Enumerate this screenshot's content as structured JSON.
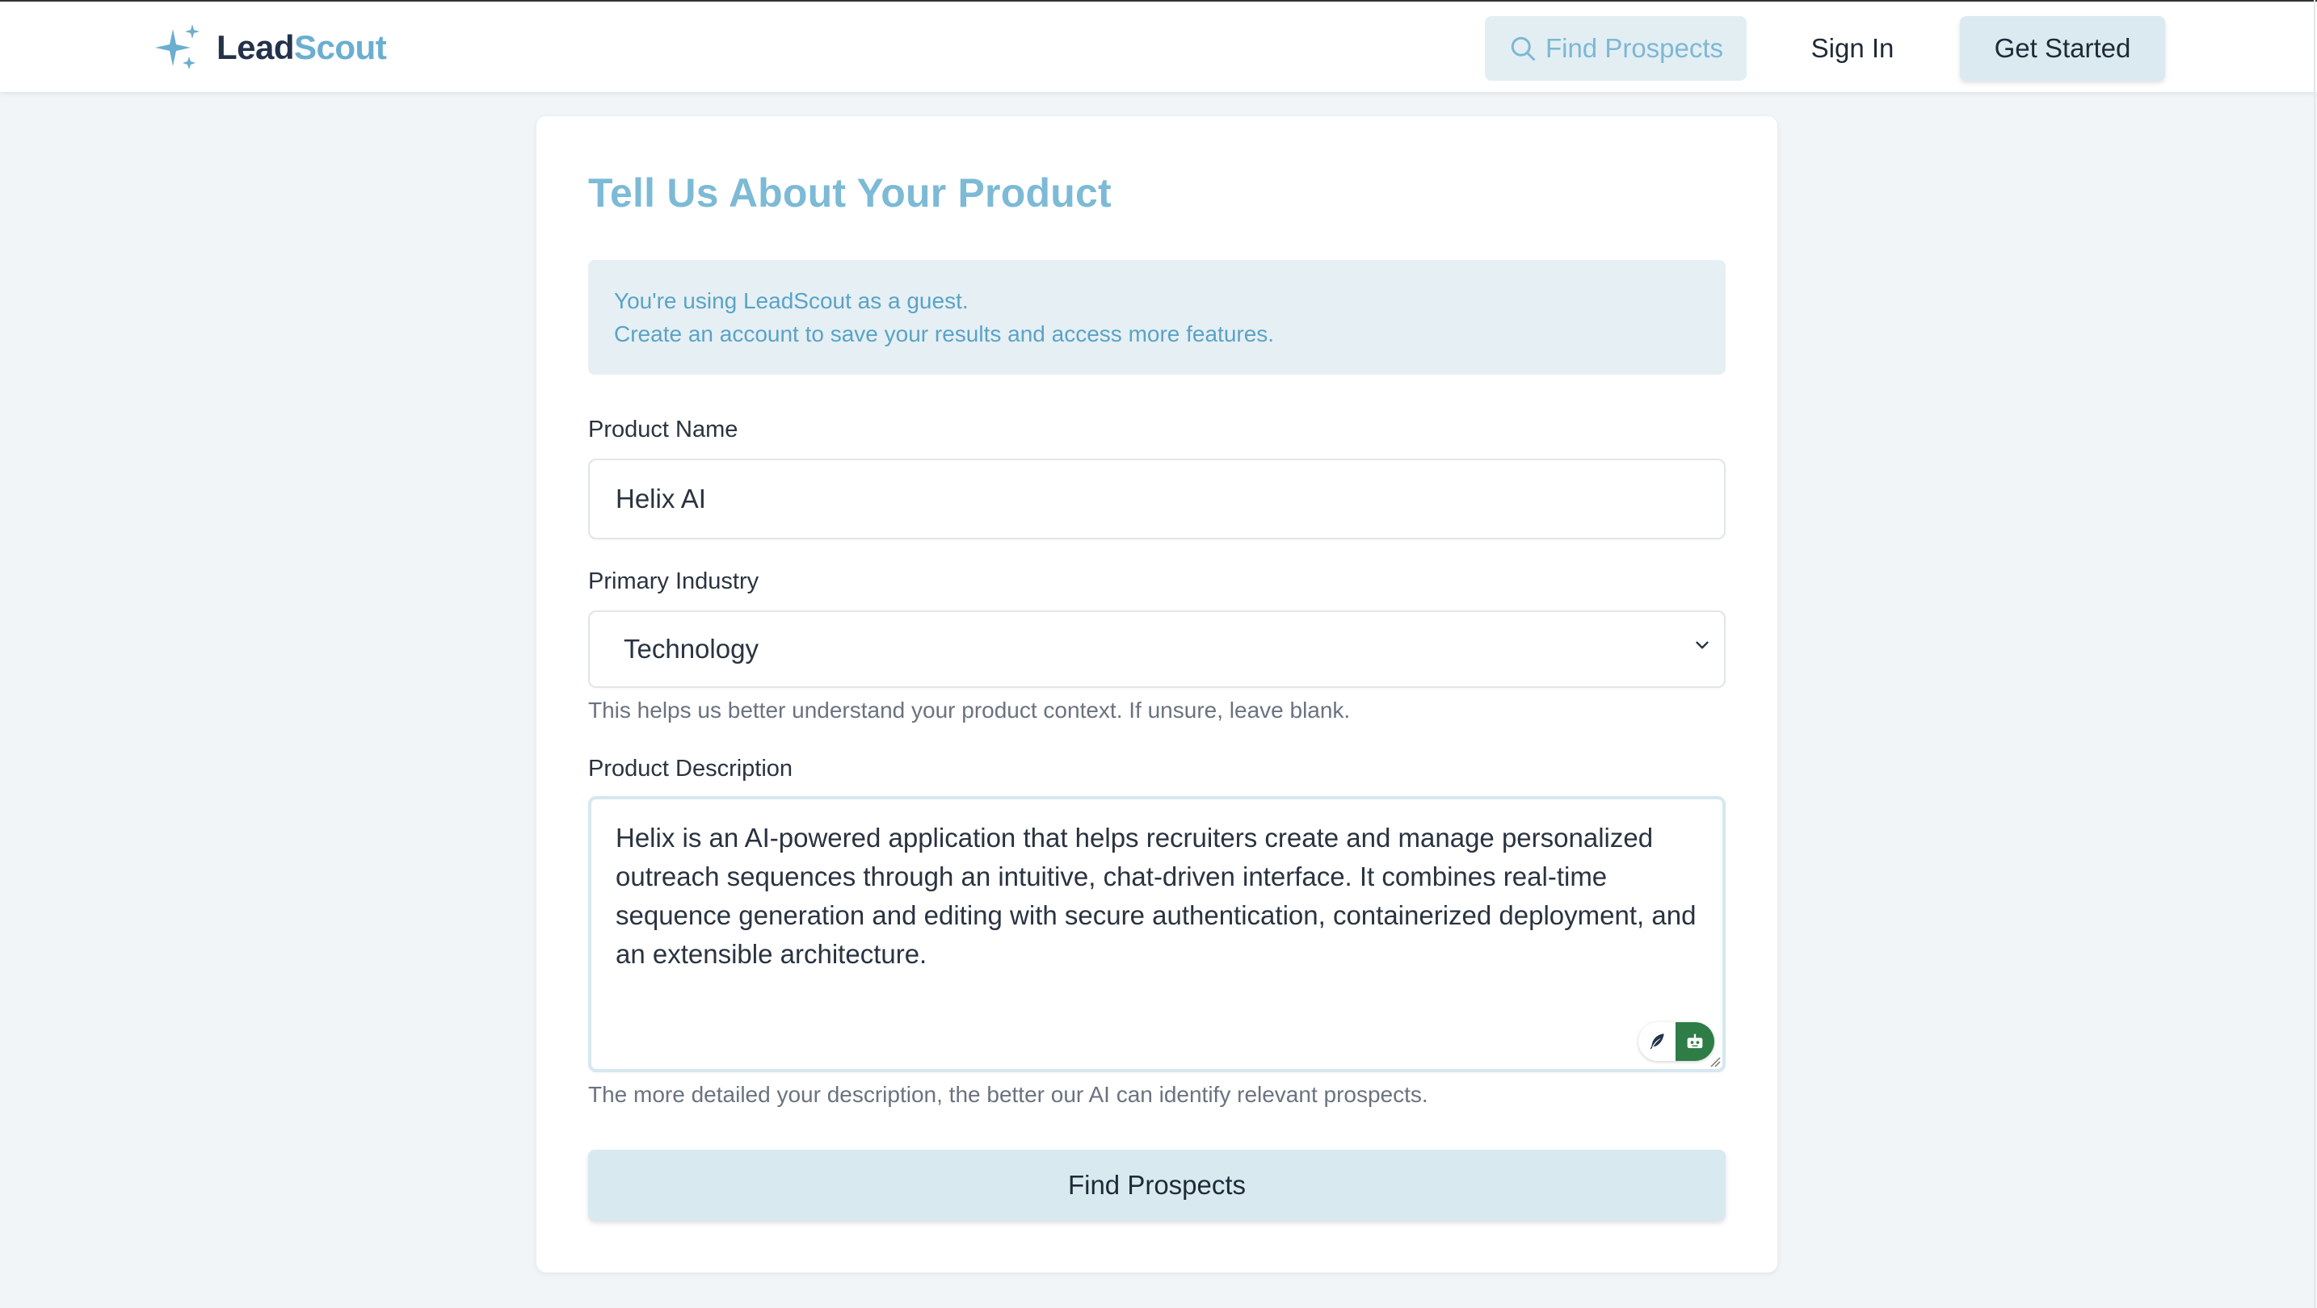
{
  "brand": {
    "name_part1": "Lead",
    "name_part2": "Scout",
    "icon": "sparkles-icon",
    "accent": "#6aaed0",
    "dark": "#23324a"
  },
  "nav": {
    "find_prospects": "Find Prospects",
    "sign_in": "Sign In",
    "get_started": "Get Started"
  },
  "form": {
    "title": "Tell Us About Your Product",
    "guest_notice": {
      "line1": "You're using LeadScout as a guest.",
      "line2": "Create an account to save your results and access more features."
    },
    "product_name": {
      "label": "Product Name",
      "value": "Helix AI"
    },
    "industry": {
      "label": "Primary Industry",
      "value": "Technology",
      "helper": "This helps us better understand your product context. If unsure, leave blank."
    },
    "description": {
      "label": "Product Description",
      "value": "Helix is an AI-powered application that helps recruiters create and manage personalized outreach sequences through an intuitive, chat-driven interface. It combines real-time sequence generation and editing with secure authentication, containerized deployment, and an extensible architecture.",
      "helper": "The more detailed your description, the better our AI can identify relevant prospects."
    },
    "submit": "Find Prospects"
  }
}
